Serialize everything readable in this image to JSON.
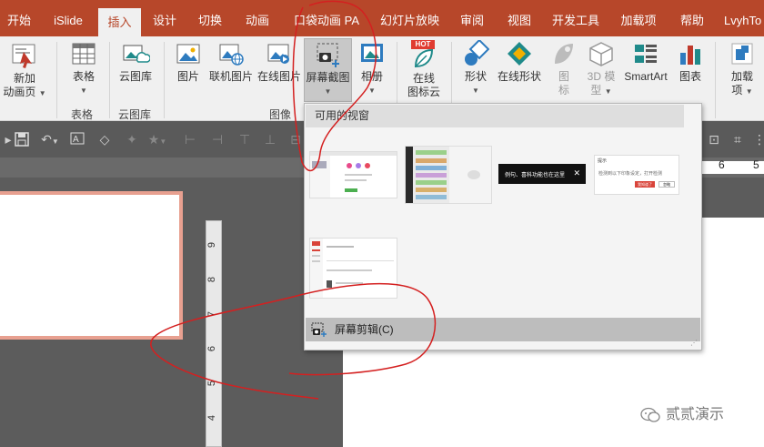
{
  "tabs": [
    "开始",
    "iSlide",
    "插入",
    "设计",
    "切换",
    "动画",
    "口袋动画 PA",
    "幻灯片放映",
    "审阅",
    "视图",
    "开发工具",
    "加载项",
    "帮助",
    "LvyhTo"
  ],
  "ribbon": {
    "new_slide": "新加",
    "new_slide2": "动画页",
    "table": "表格",
    "cloud_chart": "云图库",
    "picture": "图片",
    "online_picture": "联机图片",
    "online_picture2": "在线图片",
    "screenshot": "屏幕截图",
    "album": "相册",
    "online_icon": "在线",
    "online_icon2": "图标云",
    "hot_badge": "HOT",
    "shape": "形状",
    "online_shape": "在线形状",
    "icon": "图",
    "icon2": "标",
    "model3d": "3D 模",
    "model3d2": "型",
    "smartart": "SmartArt",
    "chart": "图表",
    "addin": "加载",
    "addin2": "项",
    "group_table": "表格",
    "group_cloud": "云图库",
    "group_image": "图像"
  },
  "ruler": {
    "h_left": "6",
    "h_right": "5",
    "v_numbers": [
      "9",
      "8",
      "7",
      "6",
      "5",
      "4"
    ]
  },
  "panel": {
    "header": "可用的视窗",
    "thumb_dark_text": "例句、喜科功能也在这里",
    "thumb_light_title": "提示",
    "thumb_light_text": "检测到以下印象设定，打开检测",
    "thumb_light_btn1": "我知道了",
    "thumb_light_btn2": "忽略",
    "footer": "屏幕剪辑(C)"
  },
  "watermark": "贰贰演示"
}
